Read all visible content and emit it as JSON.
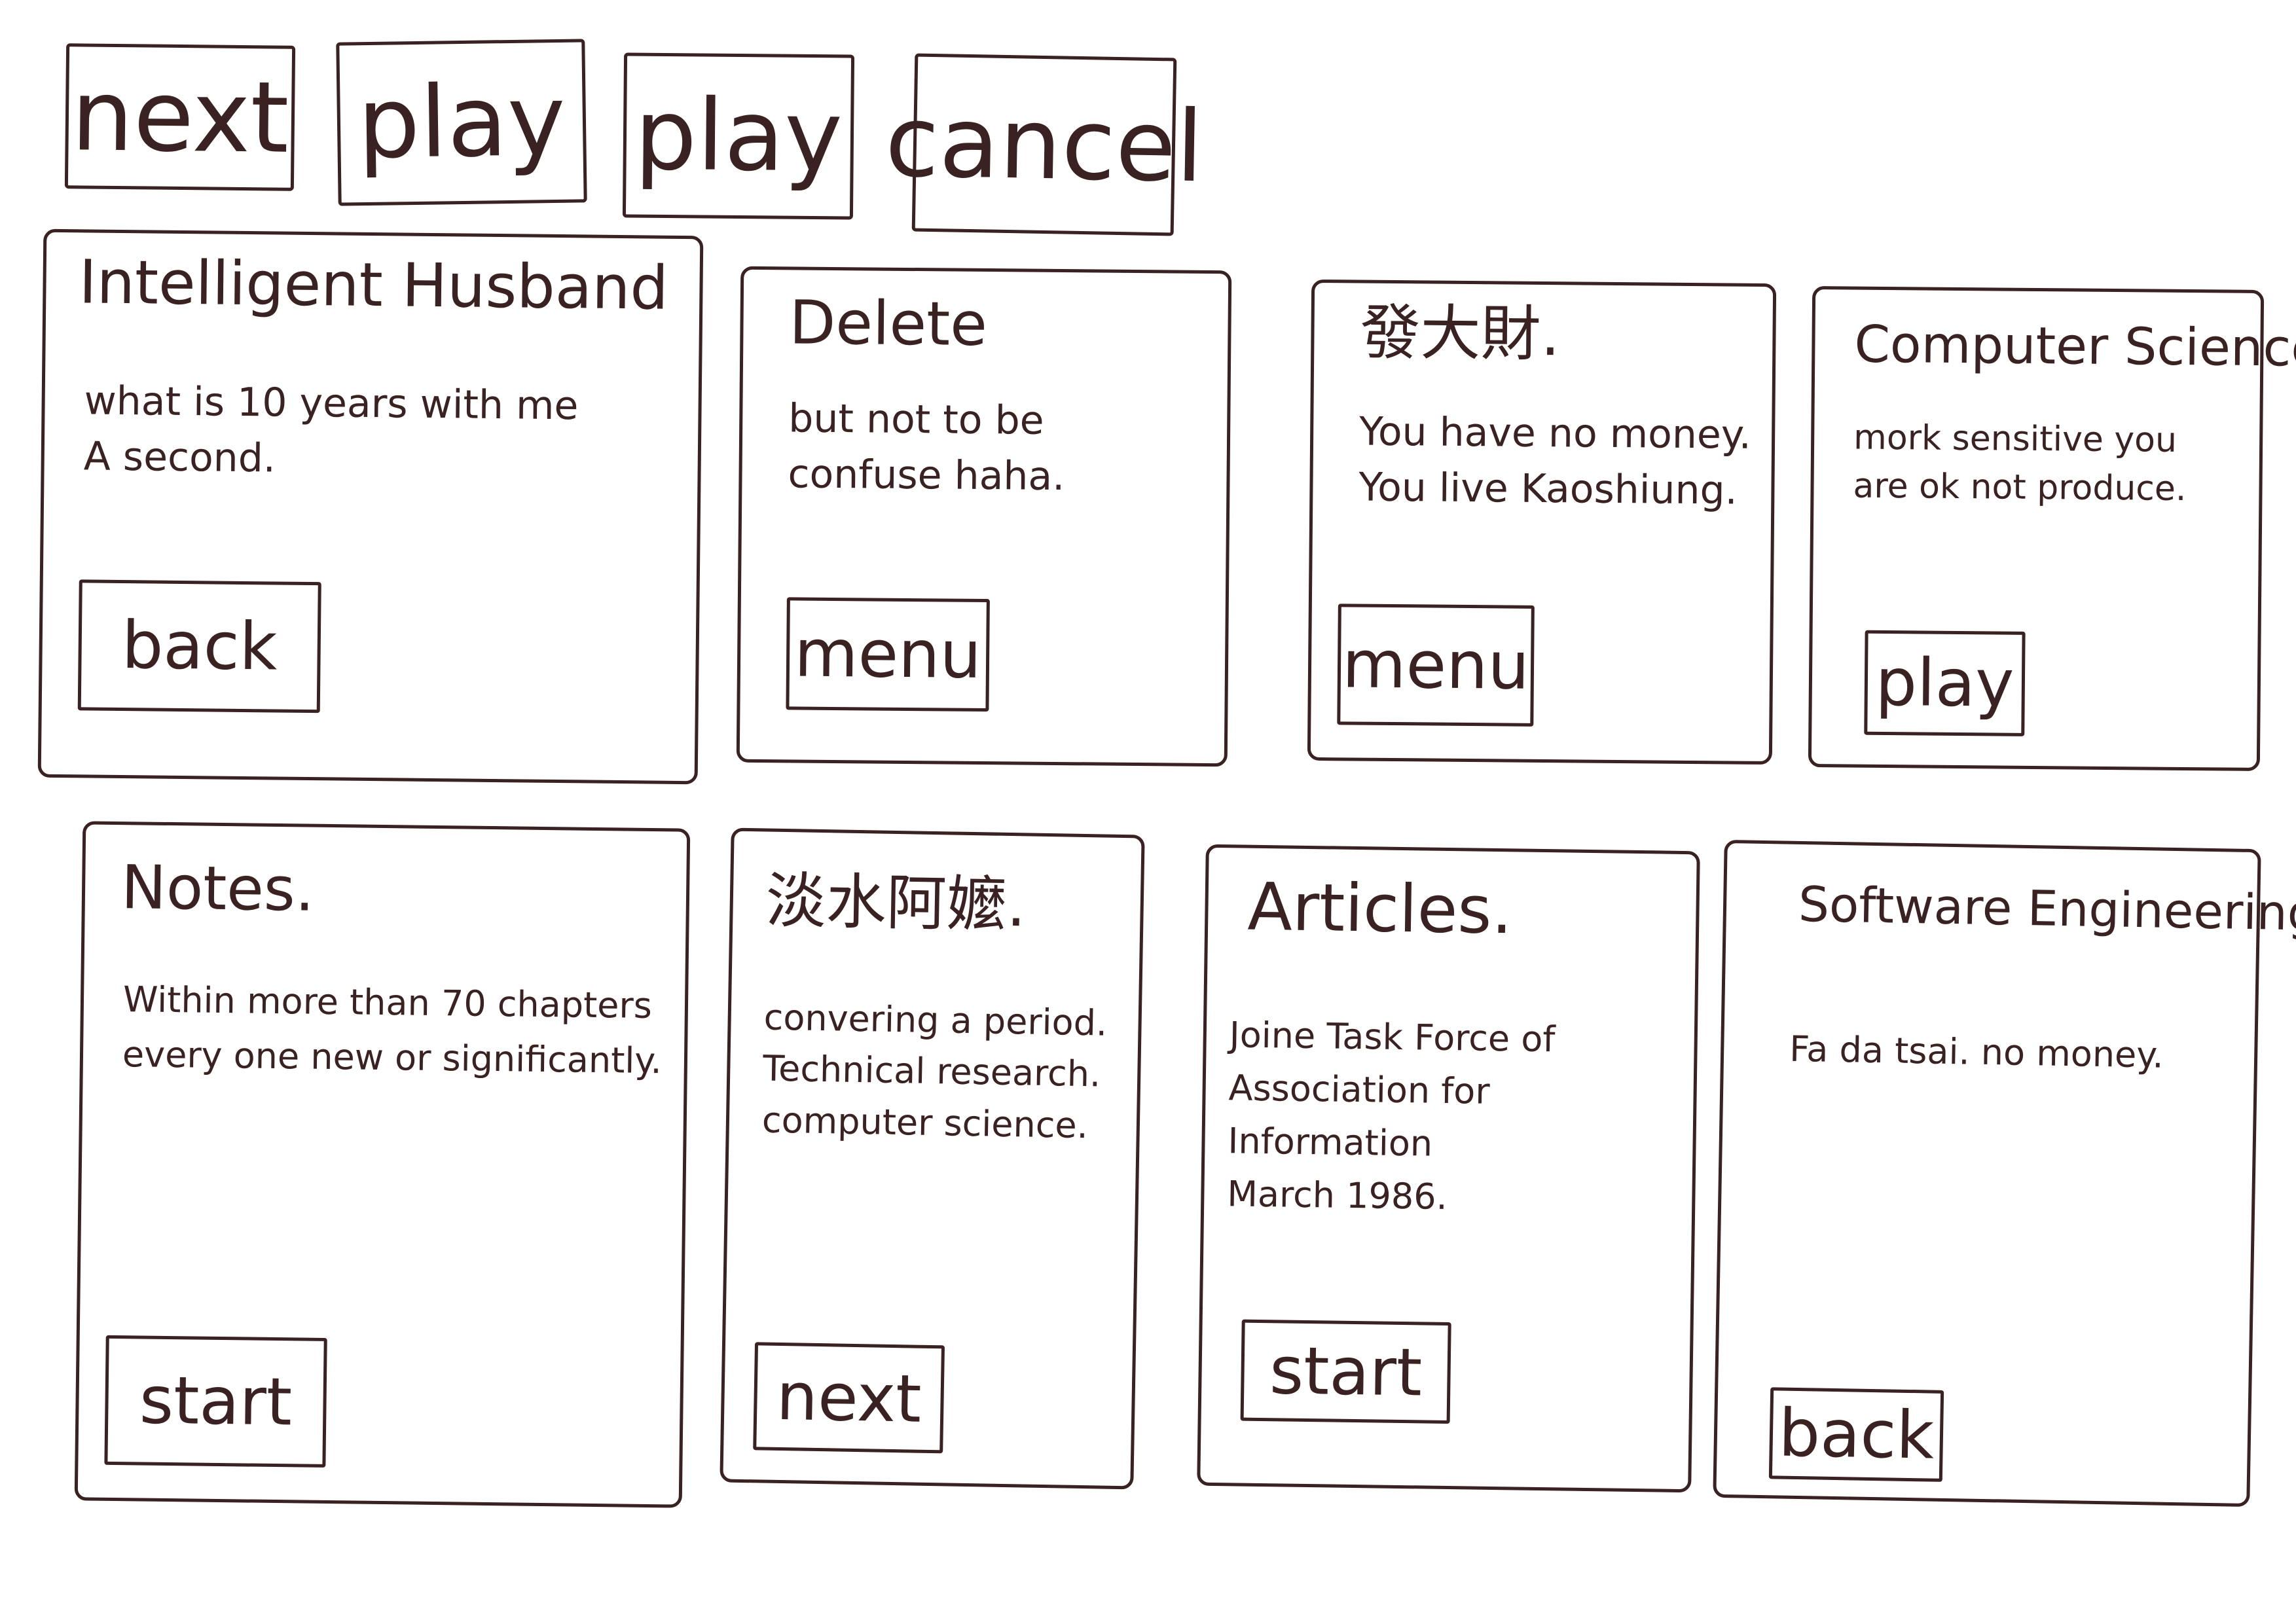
{
  "colors": {
    "ink": "#3a2222",
    "paper": "#ffffff"
  },
  "toolbar": {
    "buttons": [
      {
        "label": "next"
      },
      {
        "label": "play"
      },
      {
        "label": "play"
      },
      {
        "label": "cancel"
      }
    ]
  },
  "cards": [
    {
      "title": "Intelligent Husband",
      "body": "what is 10 years with me\nA second.",
      "button": "back"
    },
    {
      "title": "Delete",
      "body": "but not to be\nconfuse haha.",
      "button": "menu"
    },
    {
      "title": "發大財.",
      "body": "You have no money.\nYou live Kaoshiung.",
      "button": "menu"
    },
    {
      "title": "Computer Science.",
      "body": "mork sensitive you\nare ok not produce.",
      "button": "play"
    },
    {
      "title": "Notes.",
      "body": "Within more than 70 chapters\nevery one new or significantly.",
      "button": "start"
    },
    {
      "title": "淡水阿嬤.",
      "body": "convering a period.\nTechnical research.\ncomputer science.",
      "button": "next"
    },
    {
      "title": "Articles.",
      "body": "Joine Task Force of\nAssociation for Information\nMarch 1986.",
      "button": "start"
    },
    {
      "title": "Software Engineering.",
      "body": "Fa da tsai. no money.",
      "button": "back"
    }
  ]
}
